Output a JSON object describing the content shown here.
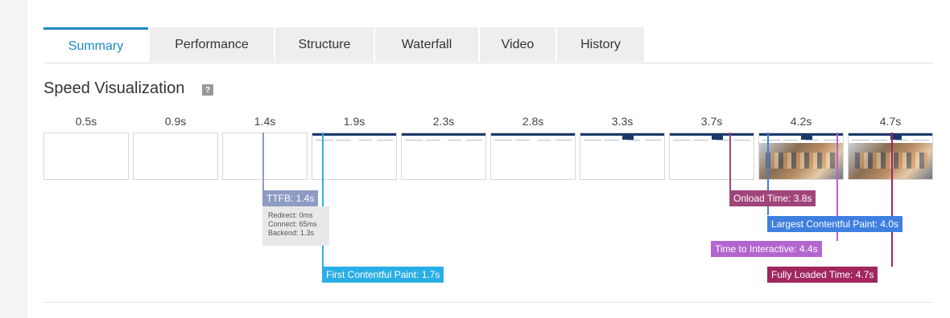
{
  "tabs": [
    {
      "label": "Summary",
      "active": true
    },
    {
      "label": "Performance",
      "active": false
    },
    {
      "label": "Structure",
      "active": false
    },
    {
      "label": "Waterfall",
      "active": false
    },
    {
      "label": "Video",
      "active": false
    },
    {
      "label": "History",
      "active": false
    }
  ],
  "section": {
    "title": "Speed Visualization",
    "help": "?"
  },
  "timeline": {
    "times": [
      "0.5s",
      "0.9s",
      "1.4s",
      "1.9s",
      "2.3s",
      "2.8s",
      "3.3s",
      "3.7s",
      "4.2s",
      "4.7s"
    ],
    "frame_states": [
      "blank",
      "blank",
      "blank",
      "text",
      "text",
      "text",
      "text",
      "text",
      "photo",
      "photo"
    ]
  },
  "ttfb": {
    "label": "TTFB: 1.4s",
    "redirect": "Redirect: 0ms",
    "connect": "Connect: 65ms",
    "backend": "Backend: 1.3s"
  },
  "markers": {
    "fcp": "First Contentful Paint: 1.7s",
    "onload": "Onload Time: 3.8s",
    "lcp": "Largest Contentful Paint: 4.0s",
    "tti": "Time to Interactive: 4.4s",
    "fully": "Fully Loaded Time: 4.7s"
  },
  "colors": {
    "accent": "#1e88c8",
    "ttfb": "#8e9bc3",
    "fcp": "#29aee6",
    "onload": "#a0457a",
    "lcp": "#3f7fe0",
    "tti": "#b265cf",
    "fully": "#a12660"
  }
}
